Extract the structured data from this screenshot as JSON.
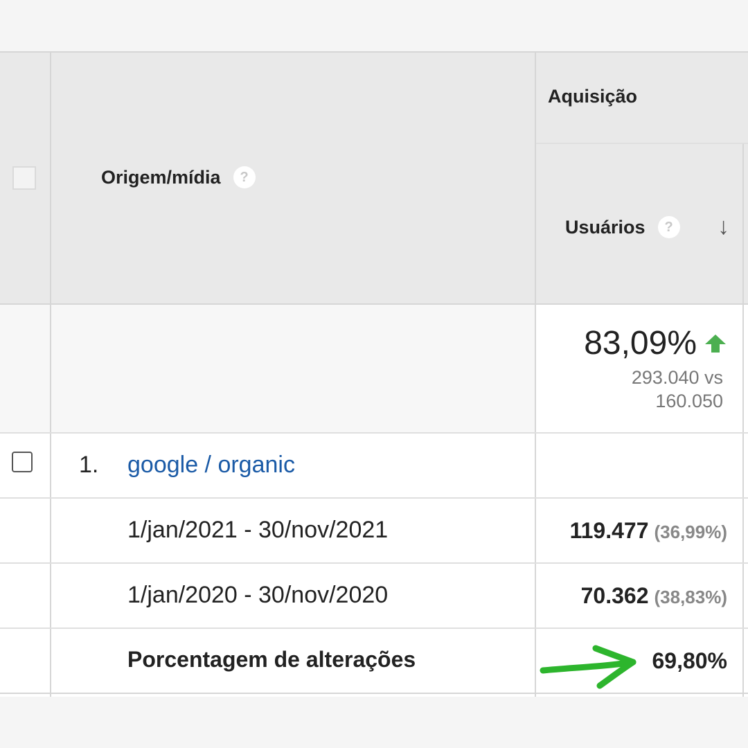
{
  "table": {
    "header": {
      "group_label": "Aquisição",
      "dimension_label": "Origem/mídia",
      "metric_label": "Usuários",
      "help_icon": "?",
      "sort_icon": "↓"
    },
    "summary": {
      "change": "83,09%",
      "trend_icon": "arrow-up",
      "comparison_line1": "293.040 vs",
      "comparison_line2": "160.050"
    },
    "rows": [
      {
        "index": "1.",
        "source": "google / organic"
      }
    ],
    "subrows": [
      {
        "label": "1/jan/2021 - 30/nov/2021",
        "value": "119.477",
        "share": "(36,99%)"
      },
      {
        "label": "1/jan/2020 - 30/nov/2020",
        "value": "70.362",
        "share": "(38,83%)"
      },
      {
        "label": "Porcentagem de alterações",
        "value": "69,80%"
      }
    ],
    "colors": {
      "accent_green": "#2db52d",
      "link_blue": "#1a5aa6",
      "trend_green": "#4caf50"
    }
  }
}
